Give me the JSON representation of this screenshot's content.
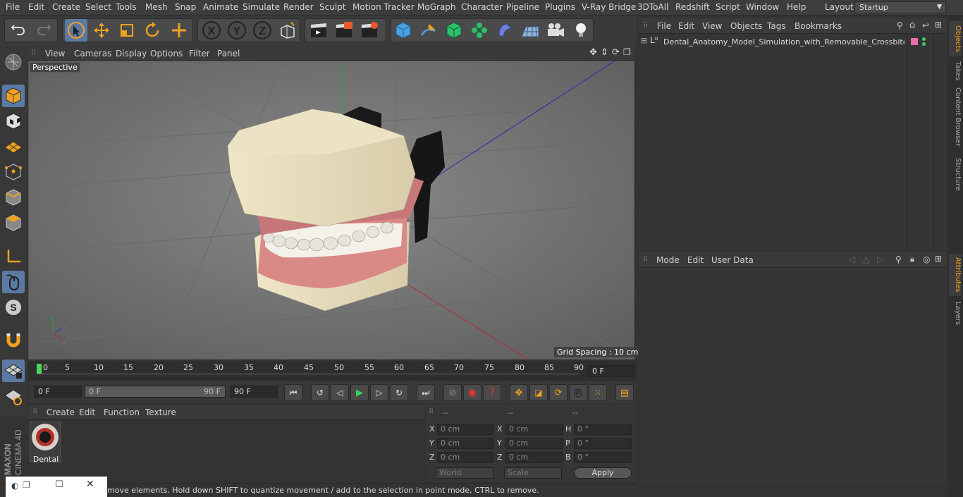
{
  "menu": [
    "File",
    "Edit",
    "Create",
    "Select",
    "Tools",
    "Mesh",
    "Snap",
    "Animate",
    "Simulate",
    "Render",
    "Sculpt",
    "Motion Tracker",
    "MoGraph",
    "Character",
    "Pipeline",
    "Plugins",
    "V-Ray Bridge",
    "3DToAll",
    "Redshift",
    "Script",
    "Window",
    "Help"
  ],
  "layout": {
    "label": "Layout:",
    "value": "Startup"
  },
  "viewport": {
    "menu": [
      "View",
      "Cameras",
      "Display",
      "Options",
      "Filter",
      "Panel"
    ],
    "label": "Perspective",
    "grid_spacing": "Grid Spacing : 10 cm"
  },
  "timeline": {
    "ticks": [
      "0",
      "5",
      "10",
      "15",
      "20",
      "25",
      "30",
      "35",
      "40",
      "45",
      "50",
      "55",
      "60",
      "65",
      "70",
      "75",
      "80",
      "85",
      "90"
    ],
    "current_frame": "0 F",
    "start_field": "0 F",
    "range_start": "0 F",
    "range_end": "90 F",
    "end_field": "90 F"
  },
  "material": {
    "menu": [
      "Create",
      "Edit",
      "Function",
      "Texture"
    ],
    "item_name": "Dental"
  },
  "coords": {
    "headers": [
      "--",
      "--",
      "--"
    ],
    "rows": [
      {
        "a_label": "X",
        "a_value": "0 cm",
        "b_label": "X",
        "b_value": "0 cm",
        "c_label": "H",
        "c_value": "0 °"
      },
      {
        "a_label": "Y",
        "a_value": "0 cm",
        "b_label": "Y",
        "b_value": "0 cm",
        "c_label": "P",
        "c_value": "0 °"
      },
      {
        "a_label": "Z",
        "a_value": "0 cm",
        "b_label": "Z",
        "b_value": "0 cm",
        "c_label": "B",
        "c_value": "0 °"
      }
    ],
    "mode_select": "World",
    "scale_select": "Scale",
    "apply": "Apply"
  },
  "objects": {
    "menu": [
      "File",
      "Edit",
      "View",
      "Objects",
      "Tags",
      "Bookmarks"
    ],
    "item": "Dental_Anatomy_Model_Simulation_with_Removable_Crossbite_Te"
  },
  "attributes": {
    "menu": [
      "Mode",
      "Edit",
      "User Data"
    ]
  },
  "right_tabs": [
    "Objects",
    "Takes",
    "Content Browser",
    "Structure",
    "Attributes",
    "Layers"
  ],
  "status": "move elements. Hold down SHIFT to quantize movement / add to the selection in point mode, CTRL to remove.",
  "brand": {
    "maxon": "MAXON",
    "product": "CINEMA 4D"
  },
  "colors": {
    "accent_blue": "#5b7aa3",
    "tag_pink": "#e86fa5",
    "tag_green": "#44cc66"
  }
}
